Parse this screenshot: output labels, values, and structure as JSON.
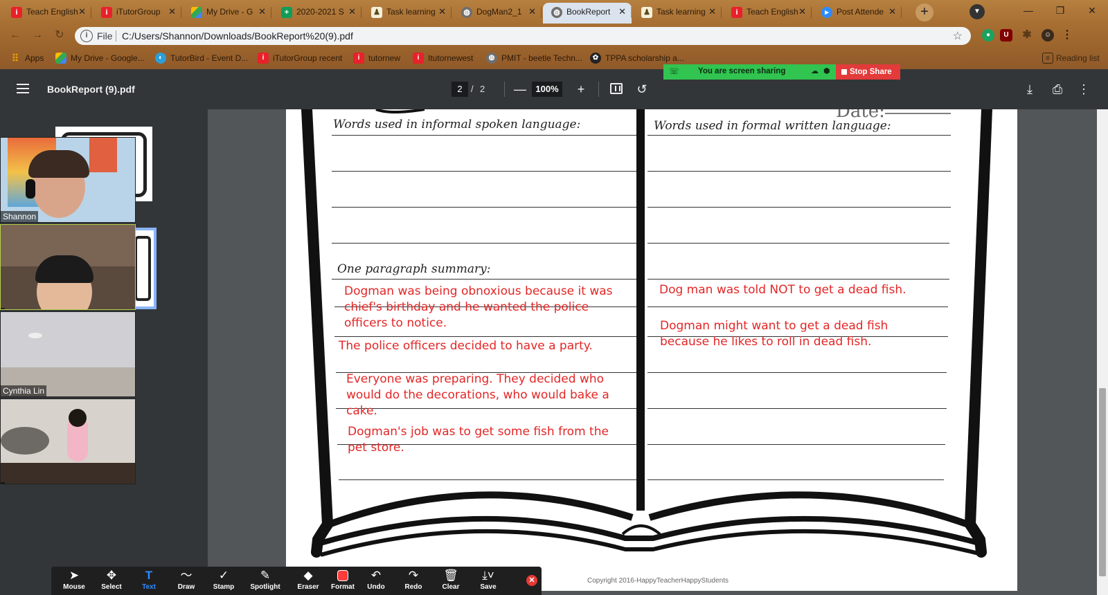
{
  "browser": {
    "tabs": [
      {
        "title": "Teach English",
        "icon": "itutor-icon",
        "active": false
      },
      {
        "title": "iTutorGroup",
        "icon": "itutor-icon",
        "active": false
      },
      {
        "title": "My Drive - G",
        "icon": "drive-icon",
        "active": false
      },
      {
        "title": "2020-2021 S",
        "icon": "sheets-icon",
        "active": false
      },
      {
        "title": "Task learning",
        "icon": "task-icon",
        "active": false
      },
      {
        "title": "DogMan2_1",
        "icon": "globe-icon",
        "active": false
      },
      {
        "title": "BookReport",
        "icon": "globe-icon",
        "active": true
      },
      {
        "title": "Task learning",
        "icon": "task-icon",
        "active": false
      },
      {
        "title": "Teach English",
        "icon": "itutor-icon",
        "active": false
      },
      {
        "title": "Post Attende",
        "icon": "zoom-icon",
        "active": false
      }
    ],
    "address": {
      "scheme": "File",
      "url": "C:/Users/Shannon/Downloads/BookReport%20(9).pdf"
    },
    "bookmarks": [
      {
        "label": "Apps",
        "icon": "apps-grid-icon"
      },
      {
        "label": "My Drive - Google...",
        "icon": "drive-icon"
      },
      {
        "label": "TutorBird - Event D...",
        "icon": "tutorbird-icon"
      },
      {
        "label": "iTutorGroup recent",
        "icon": "itutor-icon"
      },
      {
        "label": "tutornew",
        "icon": "itutor-icon"
      },
      {
        "label": "Itutornewest",
        "icon": "itutor-icon"
      },
      {
        "label": "PMIT - beetle Techn...",
        "icon": "globe-icon"
      },
      {
        "label": "TPPA scholarship a...",
        "icon": "tppa-icon"
      }
    ],
    "reading_list": "Reading list"
  },
  "screen_share": {
    "status": "You are screen sharing",
    "stop_label": "Stop Share"
  },
  "pdf": {
    "title": "BookReport (9).pdf",
    "page_current": "2",
    "page_total": "2",
    "zoom": "100%",
    "page": {
      "left_header": "Words used in informal spoken language:",
      "right_header": "Words used in formal written language:",
      "summary_header": "One paragraph summary:",
      "date_label": "Date:",
      "left_annotations": [
        "Dogman was being obnoxious because it was chief's birthday and he wanted the police officers to notice.",
        "The police officers decided to have a party.",
        "Everyone was preparing. They decided who would do the decorations, who would bake a cake.",
        "Dogman's job was to get some fish from the pet store."
      ],
      "right_annotations": [
        "Dog man was told NOT to get a dead fish.",
        "Dogman might want to get a dead fish because he likes to roll in dead fish."
      ],
      "copyright": "Copyright 2016-HappyTeacherHappyStudents"
    }
  },
  "participants": [
    {
      "name": "Shannon"
    },
    {
      "name": ""
    },
    {
      "name": "Cynthia Lin"
    },
    {
      "name": ""
    }
  ],
  "annotation_toolbar": {
    "tools": [
      {
        "label": "Mouse",
        "icon": "cursor-icon"
      },
      {
        "label": "Select",
        "icon": "move-icon"
      },
      {
        "label": "Text",
        "icon": "text-icon",
        "active": true
      },
      {
        "label": "Draw",
        "icon": "draw-icon"
      },
      {
        "label": "Stamp",
        "icon": "checkmark-icon"
      },
      {
        "label": "Spotlight",
        "icon": "spotlight-icon"
      },
      {
        "label": "Eraser",
        "icon": "eraser-icon"
      },
      {
        "label": "Format",
        "icon": "format-swatch"
      },
      {
        "label": "Undo",
        "icon": "undo-icon"
      },
      {
        "label": "Redo",
        "icon": "redo-icon"
      },
      {
        "label": "Clear",
        "icon": "trash-icon"
      },
      {
        "label": "Save",
        "icon": "save-icon"
      }
    ]
  },
  "colors": {
    "annotation": "#e32626",
    "share_green": "#31c450",
    "stop_red": "#e33a3a",
    "toolbar_active": "#2d8cff"
  }
}
